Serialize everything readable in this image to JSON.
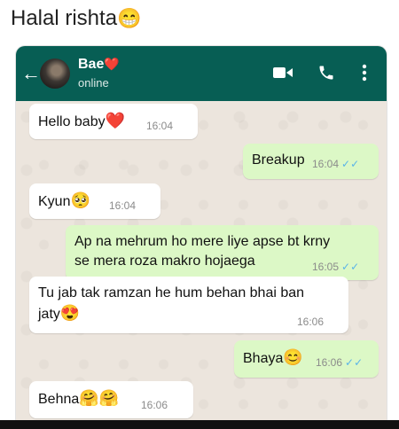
{
  "caption": {
    "text": "Halal rishta",
    "emoji": "😁"
  },
  "header": {
    "contact_name": "Bae",
    "contact_emoji": "❤️",
    "status": "online",
    "icons": [
      "back-arrow-icon",
      "video-call-icon",
      "voice-call-icon",
      "more-options-icon"
    ]
  },
  "messages": [
    {
      "direction": "in",
      "text": "Hello baby",
      "emoji": "❤️",
      "time": "16:04"
    },
    {
      "direction": "out",
      "text": "Breakup",
      "emoji": "",
      "time": "16:04"
    },
    {
      "direction": "in",
      "text": "Kyun",
      "emoji": "🥺",
      "time": "16:04"
    },
    {
      "direction": "out",
      "line1": "Ap na mehrum ho mere liye apse bt krny",
      "line2": "se mera roza makro hojaega",
      "time": "16:05"
    },
    {
      "direction": "in",
      "line1": "Tu jab tak ramzan he hum behan bhai ban",
      "line2": "jaty",
      "emoji": "😍",
      "time": "16:06"
    },
    {
      "direction": "out",
      "text": "Bhaya",
      "emoji": "😊",
      "time": "16:06"
    },
    {
      "direction": "in",
      "text": "Behna",
      "emoji": "🤗🤗",
      "time": "16:06"
    }
  ],
  "colors": {
    "header": "#075e54",
    "outgoing": "#dcf8c6",
    "incoming": "#ffffff",
    "tick": "#5ab4e8"
  }
}
